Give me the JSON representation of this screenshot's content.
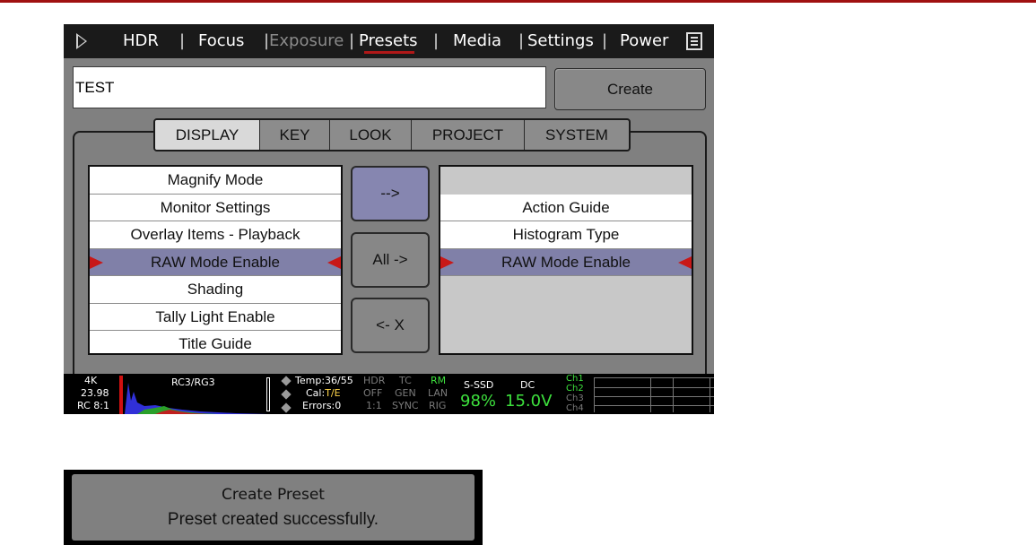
{
  "nav": {
    "hdr": "HDR",
    "focus": "Focus",
    "exposure": "Exposure",
    "presets": "Presets",
    "media": "Media",
    "settings": "Settings",
    "power": "Power",
    "separator": "|"
  },
  "preset": {
    "name_value": "TEST",
    "create_label": "Create"
  },
  "tabs": {
    "display": "DISPLAY",
    "key": "KEY",
    "look": "LOOK",
    "project": "PROJECT",
    "system": "SYSTEM"
  },
  "left_list": {
    "items": [
      "Magnify Mode",
      "Monitor Settings",
      "Overlay Items - Playback",
      "RAW Mode Enable",
      "Shading",
      "Tally Light Enable",
      "Title Guide"
    ],
    "selected": "RAW Mode Enable"
  },
  "buttons": {
    "add": "-->",
    "add_all": "All ->",
    "remove": "<- X"
  },
  "right_list": {
    "items": [
      "",
      "Action Guide",
      "Histogram Type",
      "RAW Mode Enable"
    ],
    "selected": "RAW Mode Enable"
  },
  "status_bar": {
    "resolution": "4K",
    "fps": "23.98",
    "compression": "RC 8:1",
    "color_space": "RC3/RG3",
    "temp": "Temp:36/55",
    "cal_label": "Cal:",
    "cal_value": "T/E",
    "errors": "Errors:0",
    "hdr": "HDR",
    "hdr_value": "OFF",
    "hdr_ratio": "1:1",
    "tc": "TC",
    "tc_gen": "GEN",
    "tc_sync": "SYNC",
    "rm": "RM",
    "lan": "LAN",
    "rig": "RIG",
    "media_label": "S-SSD",
    "media_percent": "98%",
    "power_label": "DC",
    "power_voltage": "15.0V",
    "channels": [
      "Ch1",
      "Ch2",
      "Ch3",
      "Ch4"
    ]
  },
  "dialog": {
    "title": "Create Preset",
    "message": "Preset created successfully."
  },
  "colors": {
    "accent_red": "#c81818",
    "selection": "#8080a8",
    "screen_gray": "#808080",
    "status_green": "#3de03d"
  }
}
